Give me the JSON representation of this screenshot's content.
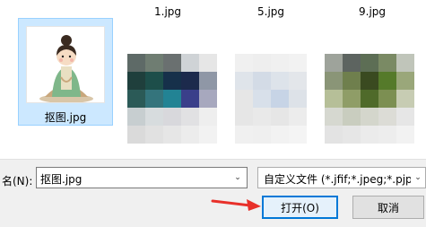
{
  "files": {
    "columns": [
      "1.jpg",
      "5.jpg",
      "9.jpg"
    ],
    "selected_file": "抠图.jpg"
  },
  "bottom": {
    "filename_label": "名(N):",
    "filename_value": "抠图.jpg",
    "filetype_value": "自定义文件 (*.jfif;*.jpeg;*.pjp;*",
    "open_button": "打开(O)",
    "cancel_button": "取消"
  },
  "colors": {
    "selection_bg": "#cce8ff",
    "accent": "#0078d7",
    "annotation_arrow": "#e8302a"
  },
  "icons": [
    "chevron-down-icon",
    "red-arrow-annotation"
  ]
}
